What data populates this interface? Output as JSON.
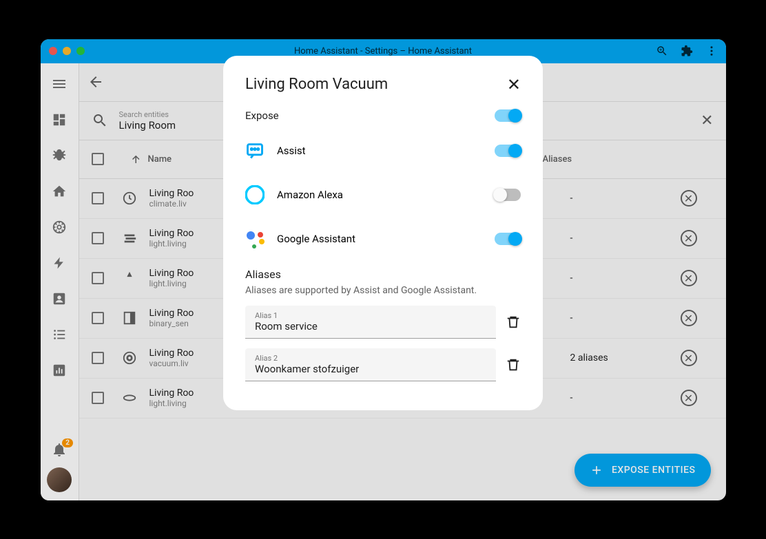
{
  "titlebar": {
    "title": "Home Assistant - Settings – Home Assistant"
  },
  "notifications": {
    "count": "2"
  },
  "search": {
    "label": "Search entities",
    "value": "Living Room"
  },
  "table": {
    "headers": {
      "name": "Name",
      "aliases": "Aliases"
    },
    "rows": [
      {
        "name": "Living Roo",
        "sub": "climate.liv",
        "aliases": "-"
      },
      {
        "name": "Living Roo",
        "sub": "light.living",
        "aliases": "-"
      },
      {
        "name": "Living Roo",
        "sub": "light.living",
        "aliases": "-"
      },
      {
        "name": "Living Roo",
        "sub": "binary_sen",
        "aliases": "-"
      },
      {
        "name": "Living Roo",
        "sub": "vacuum.liv",
        "aliases": "2 aliases"
      },
      {
        "name": "Living Roo",
        "sub": "light.living",
        "aliases": "-"
      }
    ]
  },
  "fab": {
    "label": "EXPOSE ENTITIES"
  },
  "dialog": {
    "title": "Living Room Vacuum",
    "expose_label": "Expose",
    "expose_on": true,
    "services": [
      {
        "name": "Assist",
        "on": true,
        "icon": "chat"
      },
      {
        "name": "Amazon Alexa",
        "on": false,
        "icon": "alexa"
      },
      {
        "name": "Google Assistant",
        "on": true,
        "icon": "google"
      }
    ],
    "aliases_title": "Aliases",
    "aliases_sub": "Aliases are supported by Assist and Google Assistant.",
    "aliases": [
      {
        "label": "Alias 1",
        "value": "Room service"
      },
      {
        "label": "Alias 2",
        "value": "Woonkamer stofzuiger"
      }
    ]
  }
}
